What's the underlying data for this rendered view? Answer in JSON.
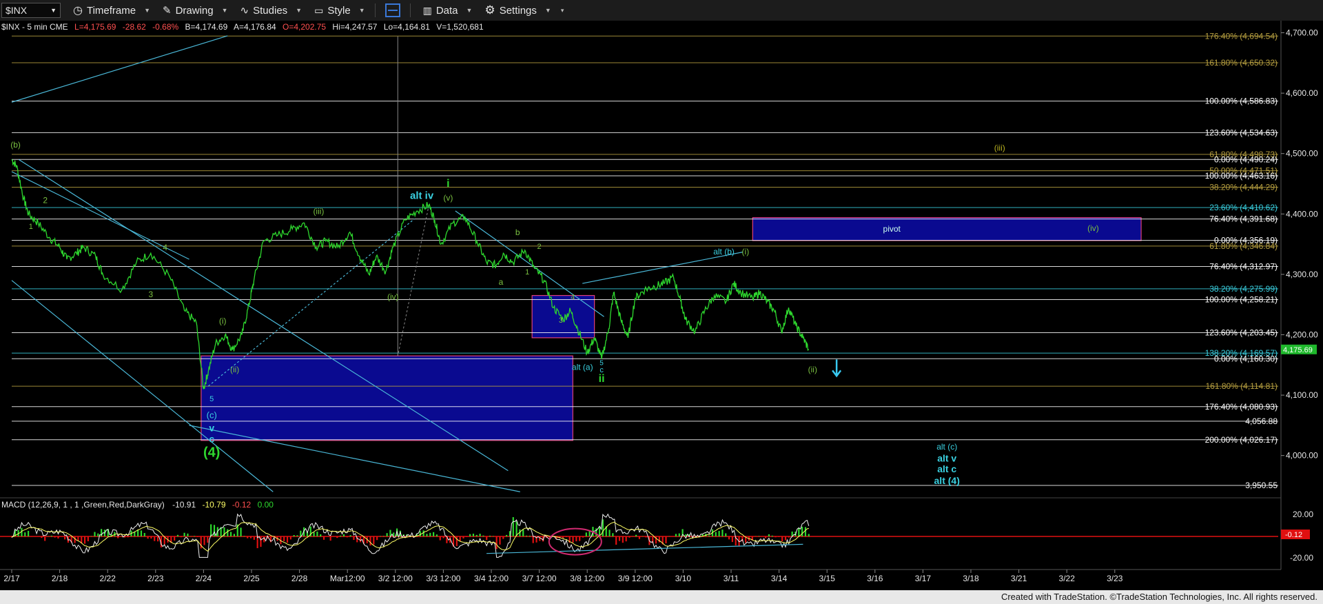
{
  "toolbar": {
    "symbol": "$INX",
    "timeframe_label": "Timeframe",
    "drawing_label": "Drawing",
    "studies_label": "Studies",
    "style_label": "Style",
    "data_label": "Data",
    "settings_label": "Settings"
  },
  "header": {
    "symbol_desc": "$INX - 5 min  CME",
    "last": "L=4,175.69",
    "change": "-28.62",
    "pct": "-0.68%",
    "bid": "B=4,174.69",
    "ask": "A=4,176.84",
    "open": "O=4,202.75",
    "high": "Hi=4,247.57",
    "low": "Lo=4,164.81",
    "volume": "V=1,520,681"
  },
  "footer": {
    "credit": "Created with TradeStation. ©TradeStation Technologies, Inc. All rights reserved."
  },
  "colors": {
    "price": "#2ed82e",
    "pivot_box": "#0a0a90",
    "macd_signal": "#ffff66",
    "hist_pos": "#2ed82e",
    "hist_neg": "#e01010",
    "label_cyan": "#3ad0e0",
    "label_green": "#7ac040",
    "fib_olive": "#b8a040"
  },
  "macd": {
    "label": "MACD (12,26,9, 1 , 1 ,Green,Red,DarkGray)",
    "v1": "-10.91",
    "v2": "-10.79",
    "v3": "-0.12",
    "v4": "0.00",
    "y_ticks": [
      "20.00",
      "-20.00"
    ],
    "last_tag": "-0.12"
  },
  "chart_data": {
    "type": "line",
    "symbol": "$INX",
    "interval": "5 min",
    "ylim": [
      3930,
      4720
    ],
    "y_ticks": [
      {
        "value": 4700,
        "label": "4,700.00"
      },
      {
        "value": 4600,
        "label": "4,600.00"
      },
      {
        "value": 4500,
        "label": "4,500.00"
      },
      {
        "value": 4400,
        "label": "4,400.00"
      },
      {
        "value": 4300,
        "label": "4,300.00"
      },
      {
        "value": 4200,
        "label": "4,200.00"
      },
      {
        "value": 4100,
        "label": "4,100.00"
      },
      {
        "value": 4000,
        "label": "4,000.00"
      }
    ],
    "last_price_tag": "4,175.69",
    "last_price": 4175.69,
    "x_ticks": [
      "2/17",
      "2/18",
      "2/22",
      "2/23",
      "2/24",
      "2/25",
      "2/28",
      "Mar12:00",
      "3/2 12:00",
      "3/3 12:00",
      "3/4 12:00",
      "3/7 12:00",
      "3/8 12:00",
      "3/9 12:00",
      "3/10",
      "3/11",
      "3/14",
      "3/15",
      "3/16",
      "3/17",
      "3/18",
      "3/21",
      "3/22",
      "3/23"
    ],
    "x_tick_index": [
      0,
      1,
      2,
      3,
      4,
      5,
      6,
      7,
      8,
      9,
      10,
      11,
      12,
      13,
      14,
      15,
      16,
      17,
      18,
      19,
      20,
      21,
      22,
      23
    ],
    "price_path": [
      [
        0,
        4490
      ],
      [
        0.1,
        4480
      ],
      [
        0.25,
        4425
      ],
      [
        0.35,
        4400
      ],
      [
        0.55,
        4385
      ],
      [
        0.8,
        4360
      ],
      [
        1.0,
        4345
      ],
      [
        1.15,
        4325
      ],
      [
        1.35,
        4335
      ],
      [
        1.5,
        4345
      ],
      [
        1.75,
        4330
      ],
      [
        1.9,
        4300
      ],
      [
        2.3,
        4275
      ],
      [
        2.6,
        4320
      ],
      [
        2.9,
        4335
      ],
      [
        3.3,
        4295
      ],
      [
        3.6,
        4240
      ],
      [
        3.85,
        4220
      ],
      [
        4.0,
        4110
      ],
      [
        4.1,
        4140
      ],
      [
        4.25,
        4185
      ],
      [
        4.45,
        4200
      ],
      [
        4.6,
        4175
      ],
      [
        4.8,
        4200
      ],
      [
        4.95,
        4250
      ],
      [
        5.05,
        4290
      ],
      [
        5.25,
        4355
      ],
      [
        5.55,
        4365
      ],
      [
        5.85,
        4375
      ],
      [
        6.1,
        4385
      ],
      [
        6.35,
        4345
      ],
      [
        6.55,
        4355
      ],
      [
        6.8,
        4345
      ],
      [
        7.05,
        4370
      ],
      [
        7.25,
        4330
      ],
      [
        7.45,
        4300
      ],
      [
        7.6,
        4330
      ],
      [
        7.8,
        4305
      ],
      [
        7.95,
        4345
      ],
      [
        8.2,
        4390
      ],
      [
        8.45,
        4405
      ],
      [
        8.7,
        4415
      ],
      [
        8.82,
        4390
      ],
      [
        8.95,
        4350
      ],
      [
        9.2,
        4385
      ],
      [
        9.45,
        4395
      ],
      [
        9.7,
        4355
      ],
      [
        9.9,
        4320
      ],
      [
        10.1,
        4315
      ],
      [
        10.25,
        4335
      ],
      [
        10.45,
        4320
      ],
      [
        10.7,
        4340
      ],
      [
        10.9,
        4310
      ],
      [
        11.1,
        4290
      ],
      [
        11.3,
        4245
      ],
      [
        11.5,
        4225
      ],
      [
        11.65,
        4240
      ],
      [
        11.8,
        4210
      ],
      [
        12.0,
        4170
      ],
      [
        12.15,
        4195
      ],
      [
        12.3,
        4160
      ],
      [
        12.45,
        4210
      ],
      [
        12.55,
        4270
      ],
      [
        12.7,
        4225
      ],
      [
        12.85,
        4195
      ],
      [
        13.0,
        4260
      ],
      [
        13.2,
        4275
      ],
      [
        13.4,
        4280
      ],
      [
        13.6,
        4285
      ],
      [
        13.8,
        4295
      ],
      [
        13.95,
        4255
      ],
      [
        14.05,
        4225
      ],
      [
        14.25,
        4205
      ],
      [
        14.45,
        4240
      ],
      [
        14.65,
        4265
      ],
      [
        14.9,
        4255
      ],
      [
        15.05,
        4285
      ],
      [
        15.2,
        4270
      ],
      [
        15.45,
        4260
      ],
      [
        15.6,
        4270
      ],
      [
        15.75,
        4255
      ],
      [
        15.9,
        4240
      ],
      [
        16.05,
        4205
      ],
      [
        16.2,
        4245
      ],
      [
        16.35,
        4215
      ],
      [
        16.5,
        4195
      ],
      [
        16.62,
        4175.69
      ]
    ],
    "fib_levels": [
      {
        "value": 4694.54,
        "label": "176.40% (4,694.54)",
        "color": "#b8a040"
      },
      {
        "value": 4650.32,
        "label": "161.80% (4,650.32)",
        "color": "#b8a040"
      },
      {
        "value": 4586.83,
        "label": "100.00% (4,586.83)",
        "color": "#ffffff"
      },
      {
        "value": 4534.63,
        "label": "123.60% (4,534.63)",
        "color": "#ffffff"
      },
      {
        "value": 4498.73,
        "label": "61.80% (4,498.73)",
        "color": "#b8a040"
      },
      {
        "value": 4490.24,
        "label": "0.00% (4,490.24)",
        "color": "#ffffff"
      },
      {
        "value": 4471.51,
        "label": "50.00% (4,471.51)",
        "color": "#b8a040"
      },
      {
        "value": 4463.16,
        "label": "100.00% (4,463.16)",
        "color": "#ffffff"
      },
      {
        "value": 4444.29,
        "label": "38.20% (4,444.29)",
        "color": "#b8a040"
      },
      {
        "value": 4410.62,
        "label": "23.60% (4,410.62)",
        "color": "#3ad0e0"
      },
      {
        "value": 4391.68,
        "label": "76.40% (4,391.68)",
        "color": "#ffffff"
      },
      {
        "value": 4356.19,
        "label": "0.00% (4,356.19)",
        "color": "#ffffff"
      },
      {
        "value": 4346.84,
        "label": "61.80% (4,346.84)",
        "color": "#b8a040"
      },
      {
        "value": 4312.97,
        "label": "76.40% (4,312.97)",
        "color": "#ffffff"
      },
      {
        "value": 4275.99,
        "label": "38.20% (4,275.99)",
        "color": "#3ad0e0"
      },
      {
        "value": 4258.21,
        "label": "100.00% (4,258.21)",
        "color": "#ffffff"
      },
      {
        "value": 4203.45,
        "label": "123.60% (4,203.45)",
        "color": "#ffffff"
      },
      {
        "value": 4169.57,
        "label": "138.20% (4,169.57)",
        "color": "#3ad0e0"
      },
      {
        "value": 4160.3,
        "label": "0.00% (4,160.30)",
        "color": "#ffffff"
      },
      {
        "value": 4114.81,
        "label": "161.80% (4,114.81)",
        "color": "#b8a040"
      },
      {
        "value": 4080.93,
        "label": "176.40% (4,080.93)",
        "color": "#ffffff"
      },
      {
        "value": 4056.88,
        "label": "4,056.88",
        "color": "#ffffff"
      },
      {
        "value": 4026.17,
        "label": "200.00% (4,026.17)",
        "color": "#ffffff"
      },
      {
        "value": 3950.55,
        "label": "3,950.55",
        "color": "#ffffff"
      }
    ],
    "boxes": [
      {
        "label": "",
        "x0": 3.95,
        "x1": 11.7,
        "y0": 4025,
        "y1": 4165
      },
      {
        "label": "",
        "x0": 10.85,
        "x1": 12.15,
        "y0": 4195,
        "y1": 4265
      },
      {
        "label": "pivot",
        "x0": 15.45,
        "x1": 23.55,
        "y0": 4356,
        "y1": 4394
      }
    ],
    "wave_labels": [
      {
        "text": "(b)",
        "x": 0.08,
        "y": 4510,
        "color": "#7ac040",
        "size": 12
      },
      {
        "text": "2",
        "x": 0.7,
        "y": 4418,
        "color": "#7ac040",
        "size": 12
      },
      {
        "text": "1",
        "x": 0.4,
        "y": 4375,
        "color": "#7ac040",
        "size": 11
      },
      {
        "text": "3",
        "x": 2.9,
        "y": 4262,
        "color": "#7ac040",
        "size": 12
      },
      {
        "text": "4",
        "x": 3.2,
        "y": 4340,
        "color": "#7ac040",
        "size": 12
      },
      {
        "text": "(i)",
        "x": 4.4,
        "y": 4218,
        "color": "#7ac040",
        "size": 12
      },
      {
        "text": "(ii)",
        "x": 4.65,
        "y": 4138,
        "color": "#7ac040",
        "size": 12
      },
      {
        "text": "5",
        "x": 4.17,
        "y": 4090,
        "color": "#3ad0e0",
        "size": 11
      },
      {
        "text": "(c)",
        "x": 4.17,
        "y": 4062,
        "color": "#3ad0e0",
        "size": 13
      },
      {
        "text": "v",
        "x": 4.17,
        "y": 4040,
        "color": "#3ad0e0",
        "size": 14
      },
      {
        "text": "c",
        "x": 4.17,
        "y": 4022,
        "color": "#3ad0e0",
        "size": 14
      },
      {
        "text": "(4)",
        "x": 4.17,
        "y": 3998,
        "color": "#2ed82e",
        "size": 20
      },
      {
        "text": "(iii)",
        "x": 6.4,
        "y": 4400,
        "color": "#7ac040",
        "size": 12
      },
      {
        "text": "(iv)",
        "x": 7.95,
        "y": 4258,
        "color": "#7ac040",
        "size": 12
      },
      {
        "text": "alt iv",
        "x": 8.55,
        "y": 4425,
        "color": "#3ad0e0",
        "size": 15
      },
      {
        "text": "i",
        "x": 9.1,
        "y": 4445,
        "color": "#2ed82e",
        "size": 16
      },
      {
        "text": "(v)",
        "x": 9.1,
        "y": 4422,
        "color": "#7ac040",
        "size": 12
      },
      {
        "text": "b",
        "x": 10.55,
        "y": 4365,
        "color": "#7ac040",
        "size": 12
      },
      {
        "text": "a",
        "x": 10.2,
        "y": 4283,
        "color": "#7ac040",
        "size": 12
      },
      {
        "text": "1",
        "x": 10.75,
        "y": 4300,
        "color": "#7ac040",
        "size": 11
      },
      {
        "text": "2",
        "x": 11.0,
        "y": 4342,
        "color": "#7ac040",
        "size": 11
      },
      {
        "text": "4",
        "x": 11.7,
        "y": 4258,
        "color": "#7ac040",
        "size": 11
      },
      {
        "text": "3",
        "x": 11.45,
        "y": 4220,
        "color": "#7ac040",
        "size": 11
      },
      {
        "text": "alt (a)",
        "x": 11.9,
        "y": 4142,
        "color": "#3ad0e0",
        "size": 12
      },
      {
        "text": "5",
        "x": 12.3,
        "y": 4150,
        "color": "#3ad0e0",
        "size": 10
      },
      {
        "text": "c",
        "x": 12.3,
        "y": 4138,
        "color": "#3ad0e0",
        "size": 11
      },
      {
        "text": "ii",
        "x": 12.3,
        "y": 4122,
        "color": "#2ed82e",
        "size": 16
      },
      {
        "text": "alt (b)",
        "x": 14.85,
        "y": 4333,
        "color": "#3ad0e0",
        "size": 12
      },
      {
        "text": "(i)",
        "x": 15.3,
        "y": 4333,
        "color": "#7ac040",
        "size": 12
      },
      {
        "text": "(iv)",
        "x": 22.55,
        "y": 4372,
        "color": "#7ac040",
        "size": 12
      },
      {
        "text": "(iii)",
        "x": 20.6,
        "y": 4505,
        "color": "#b8b020",
        "size": 12
      },
      {
        "text": "(ii)",
        "x": 16.7,
        "y": 4138,
        "color": "#7ac040",
        "size": 12
      },
      {
        "text": "alt (c)",
        "x": 19.5,
        "y": 4010,
        "color": "#3ad0e0",
        "size": 12
      },
      {
        "text": "alt v",
        "x": 19.5,
        "y": 3990,
        "color": "#3ad0e0",
        "size": 14
      },
      {
        "text": "alt c",
        "x": 19.5,
        "y": 3972,
        "color": "#3ad0e0",
        "size": 14
      },
      {
        "text": "alt (4)",
        "x": 19.5,
        "y": 3953,
        "color": "#3ad0e0",
        "size": 14
      }
    ]
  }
}
